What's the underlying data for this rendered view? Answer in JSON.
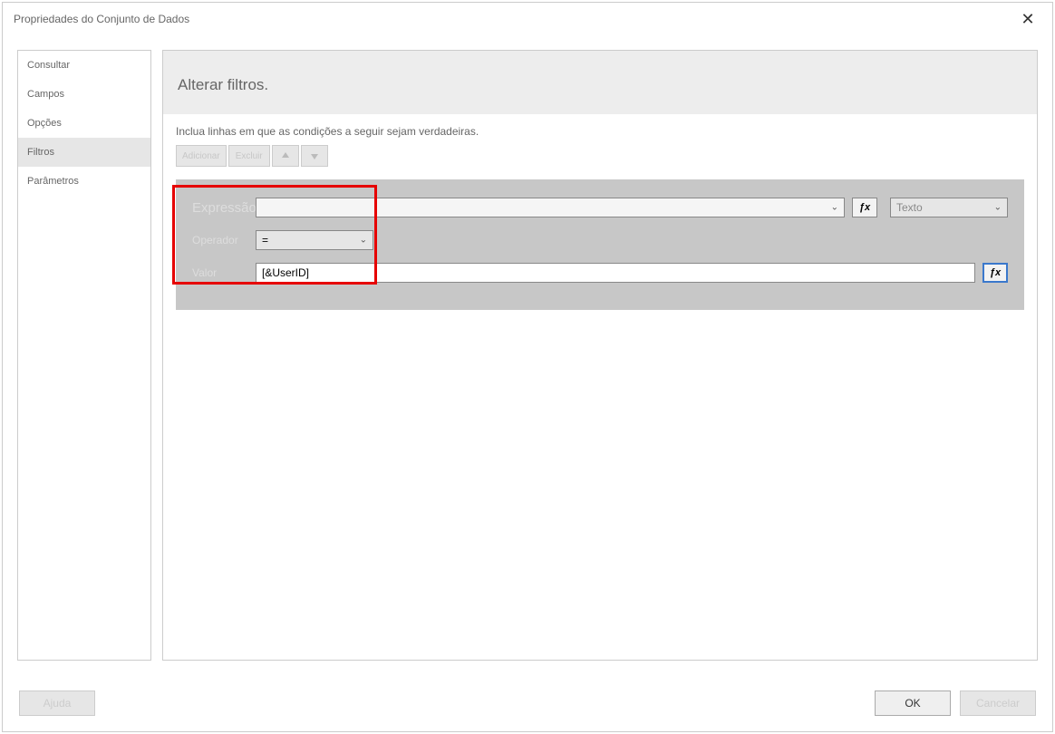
{
  "window": {
    "title": "Propriedades do Conjunto de Dados"
  },
  "sidebar": {
    "items": [
      {
        "label": "Consultar",
        "name": "sidebar-item-consultar"
      },
      {
        "label": "Campos",
        "name": "sidebar-item-campos"
      },
      {
        "label": "Opções",
        "name": "sidebar-item-opcoes"
      },
      {
        "label": "Filtros",
        "name": "sidebar-item-filtros",
        "selected": true
      },
      {
        "label": "Parâmetros",
        "name": "sidebar-item-parametros"
      }
    ]
  },
  "main": {
    "heading": "Alterar filtros.",
    "hint": "Inclua linhas em que as condições a seguir sejam verdadeiras.",
    "toolbar": {
      "add_label": "Adicionar",
      "delete_label": "Excluir"
    },
    "filter": {
      "label_expression": "Expressão",
      "expression_value": "",
      "label_operator": "Operador",
      "operator_value": "=",
      "label_value": "Valor",
      "value_value": "[&UserID]",
      "type_value": "Texto"
    }
  },
  "footer": {
    "help_label": "Ajuda",
    "ok_label": "OK",
    "cancel_label": "Cancelar"
  },
  "icons": {
    "fx": "ƒx"
  }
}
